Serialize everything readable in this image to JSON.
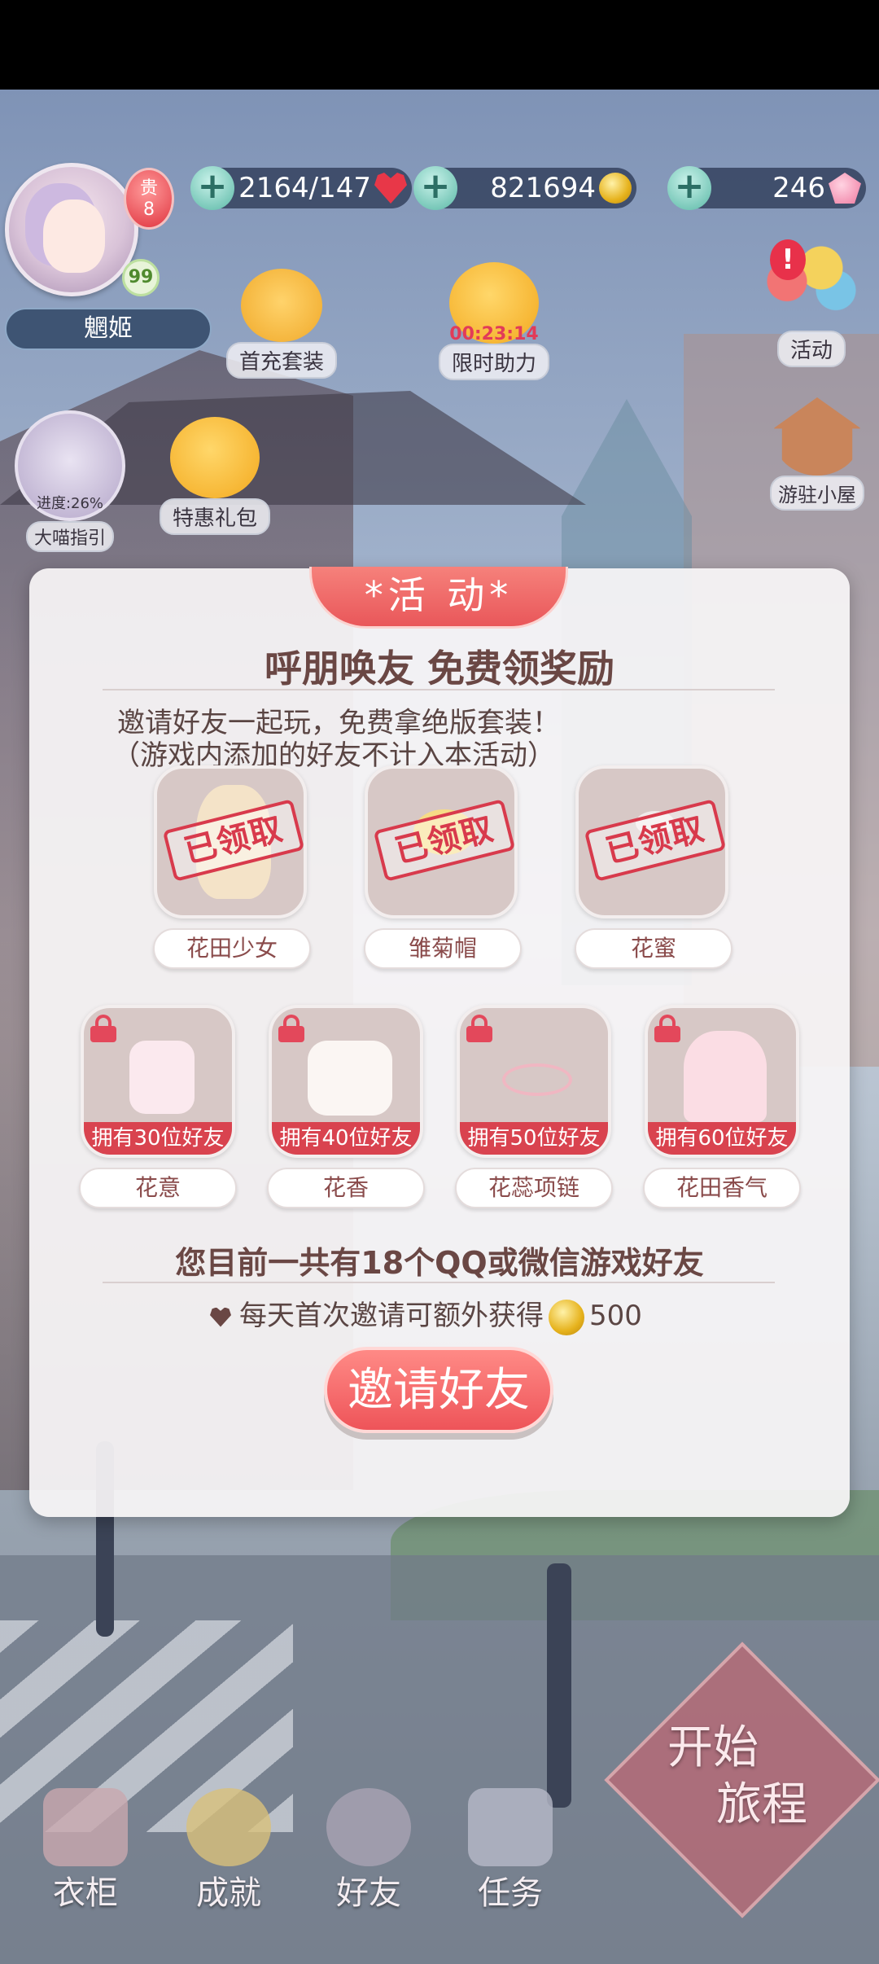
{
  "player": {
    "name": "魍姬",
    "vip_label": "贵",
    "vip_level": "8",
    "level": "99"
  },
  "resources": {
    "stamina": "2164/147",
    "coins": "821694",
    "gems": "246"
  },
  "hud": {
    "first_recharge": "首充套装",
    "timed_help": "限时助力",
    "timed_help_timer": "00:23:14",
    "activity": "活动",
    "cottage": "游驻小屋",
    "guide": "大喵指引",
    "guide_progress": "进度:26%",
    "special_pack": "特惠礼包"
  },
  "modal": {
    "tab": "*活 动*",
    "title": "呼朋唤友 免费领奖励",
    "desc_line1": "邀请好友一起玩，免费拿绝版套装！",
    "desc_line2": "（游戏内添加的好友不计入本活动）",
    "claimed_label": "已领取",
    "claimed_rewards": [
      {
        "name": "花田少女"
      },
      {
        "name": "雏菊帽"
      },
      {
        "name": "花蜜"
      }
    ],
    "locked_rewards": [
      {
        "name": "花意",
        "requirement": "拥有30位好友"
      },
      {
        "name": "花香",
        "requirement": "拥有40位好友"
      },
      {
        "name": "花蕊项链",
        "requirement": "拥有50位好友"
      },
      {
        "name": "花田香气",
        "requirement": "拥有60位好友"
      }
    ],
    "friend_count_text": "您目前一共有18个QQ或微信游戏好友",
    "bonus_text": "每天首次邀请可额外获得",
    "bonus_amount": "500",
    "invite_button": "邀请好友"
  },
  "nav": {
    "wardrobe": "衣柜",
    "achievements": "成就",
    "friends": "好友",
    "tasks": "任务"
  },
  "start": {
    "line1": "开始",
    "line2": "旅程"
  },
  "colors": {
    "accent": "#ee5459",
    "title_text": "#6a4744",
    "lock_red": "#d9434f"
  }
}
